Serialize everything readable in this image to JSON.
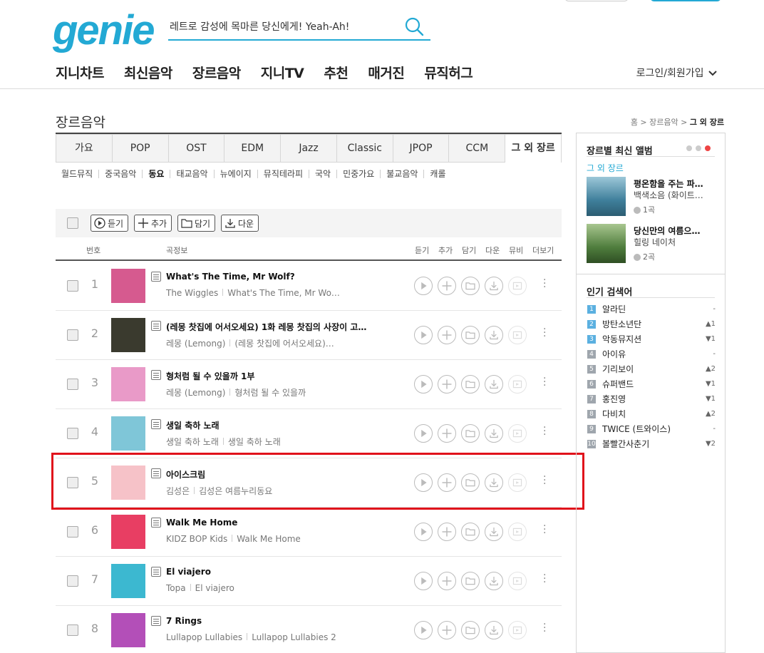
{
  "header": {
    "logo": "genie",
    "search_value": "레트로 감성에 목마른 당신에게! Yeah-Ah!",
    "nav": [
      "지니차트",
      "최신음악",
      "장르음악",
      "지니TV",
      "추천",
      "매거진",
      "뮤직허그"
    ],
    "login": "로그인/회원가입"
  },
  "page": {
    "title": "장르음악",
    "breadcrumb": [
      "홈",
      "장르음악",
      "그 외 장르"
    ]
  },
  "genre_tabs": [
    "가요",
    "POP",
    "OST",
    "EDM",
    "Jazz",
    "Classic",
    "JPOP",
    "CCM",
    "그 외 장르"
  ],
  "sub_genres": [
    "월드뮤직",
    "중국음악",
    "동요",
    "태교음악",
    "뉴에이지",
    "뮤직테라피",
    "국악",
    "민중가요",
    "불교음악",
    "캐롤"
  ],
  "toolbar": {
    "play": "듣기",
    "add": "추가",
    "save": "담기",
    "download": "다운"
  },
  "table_head": {
    "no": "번호",
    "info": "곡정보",
    "play": "듣기",
    "add": "추가",
    "save": "담기",
    "down": "다운",
    "mv": "뮤비",
    "more": "더보기"
  },
  "songs": [
    {
      "rank": "1",
      "title": "What's The Time, Mr Wolf?",
      "artist": "The Wiggles",
      "album": "What's The Time, Mr Wo…",
      "art_color": "#d65a8f"
    },
    {
      "rank": "2",
      "title": "(레몽 찻집에 어서오세요) 1화 레몽 찻집의 사장이 고…",
      "artist": "레몽 (Lemong)",
      "album": "(레몽 찻집에 어서오세요)…",
      "art_color": "#3a3a2e"
    },
    {
      "rank": "3",
      "title": "형처럼 될 수 있을까 1부",
      "artist": "레몽 (Lemong)",
      "album": "형처럼 될 수 있을까",
      "art_color": "#e99ac8"
    },
    {
      "rank": "4",
      "title": "생일 축하 노래",
      "artist": "생일 축하 노래",
      "album": "생일 축하 노래",
      "art_color": "#7fc6d8"
    },
    {
      "rank": "5",
      "title": "아이스크림",
      "artist": "김성은",
      "album": "김성은 여름누리동요",
      "art_color": "#f6c2c8"
    },
    {
      "rank": "6",
      "title": "Walk Me Home",
      "artist": "KIDZ BOP Kids",
      "album": "Walk Me Home",
      "art_color": "#e83e63"
    },
    {
      "rank": "7",
      "title": "El viajero",
      "artist": "Topa",
      "album": "El viajero",
      "art_color": "#3cb8d0"
    },
    {
      "rank": "8",
      "title": "7 Rings",
      "artist": "Lullapop Lullabies",
      "album": "Lullapop Lullabies 2",
      "art_color": "#b34fb8"
    }
  ],
  "sidebar": {
    "latest_title": "장르별 최신 앨범",
    "latest_genre": "그 외 장르",
    "albums": [
      {
        "title": "평온함을 주는 파…",
        "artist": "백색소음 (화이트…",
        "count": "1곡",
        "art_color": "#3f7f9b"
      },
      {
        "title": "당신만의 여름으…",
        "artist": "힐링 네이처",
        "count": "2곡",
        "art_color": "#4f7d3d"
      }
    ],
    "popular_title": "인기 검색어",
    "keywords": [
      {
        "rank": "1",
        "word": "알라딘",
        "change": "-"
      },
      {
        "rank": "2",
        "word": "방탄소년단",
        "change": "▲1"
      },
      {
        "rank": "3",
        "word": "악동뮤지션",
        "change": "▼1"
      },
      {
        "rank": "4",
        "word": "아이유",
        "change": "-"
      },
      {
        "rank": "5",
        "word": "기리보이",
        "change": "▲2"
      },
      {
        "rank": "6",
        "word": "슈퍼밴드",
        "change": "▼1"
      },
      {
        "rank": "7",
        "word": "홍진영",
        "change": "▼1"
      },
      {
        "rank": "8",
        "word": "다비치",
        "change": "▲2"
      },
      {
        "rank": "9",
        "word": "TWICE (트와이스)",
        "change": "-"
      },
      {
        "rank": "10",
        "word": "볼빨간사춘기",
        "change": "▼2"
      }
    ]
  },
  "colors": {
    "brand": "#23a9d4",
    "highlight": "#e0121b",
    "up": "#e44444",
    "down": "#3b8bd0"
  }
}
